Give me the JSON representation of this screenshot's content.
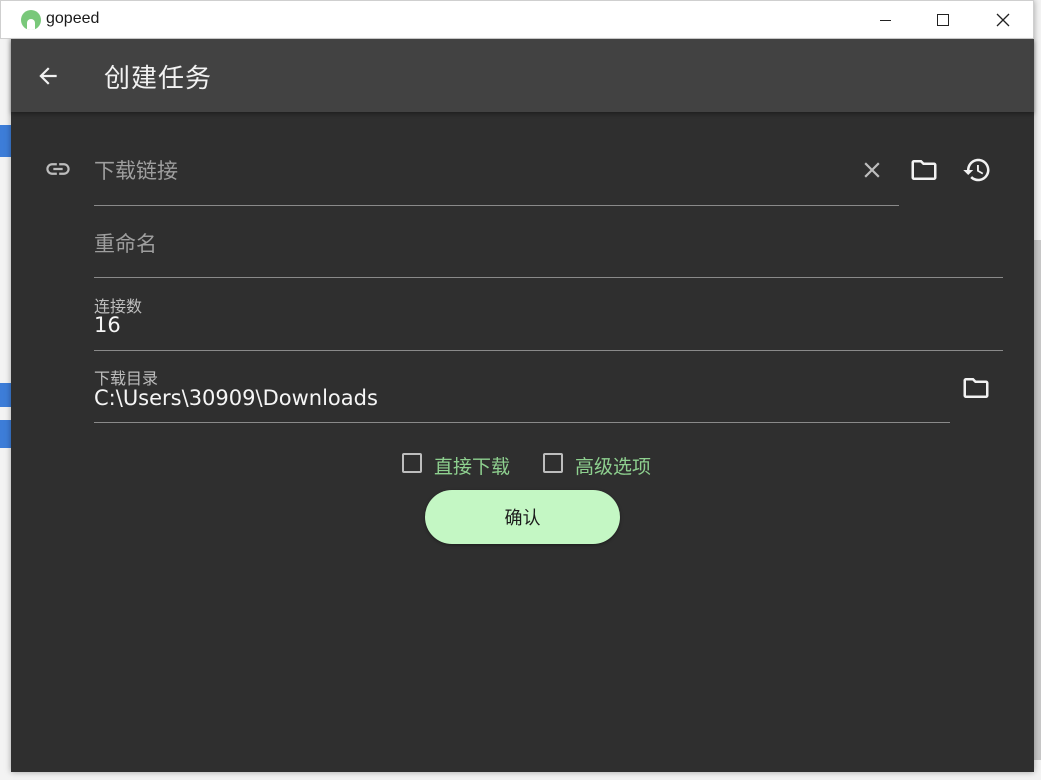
{
  "window": {
    "app_title": "gopeed",
    "controls": {
      "minimize": "minimize",
      "maximize": "maximize",
      "close": "close"
    }
  },
  "appbar": {
    "title": "创建任务",
    "back_icon": "arrow-back-icon"
  },
  "form": {
    "url": {
      "placeholder": "下载链接",
      "value": ""
    },
    "rename": {
      "placeholder": "重命名",
      "value": ""
    },
    "connections": {
      "label": "连接数",
      "value": "16"
    },
    "directory": {
      "label": "下载目录",
      "value": "C:\\Users\\30909\\Downloads"
    }
  },
  "options": {
    "direct_download": {
      "label": "直接下载",
      "checked": false
    },
    "advanced": {
      "label": "高级选项",
      "checked": false
    }
  },
  "confirm_label": "确认",
  "colors": {
    "background": "#2f2f2f",
    "appbar": "#424242",
    "accent_green": "#8ed08f",
    "button_green": "#c4f7c4"
  }
}
